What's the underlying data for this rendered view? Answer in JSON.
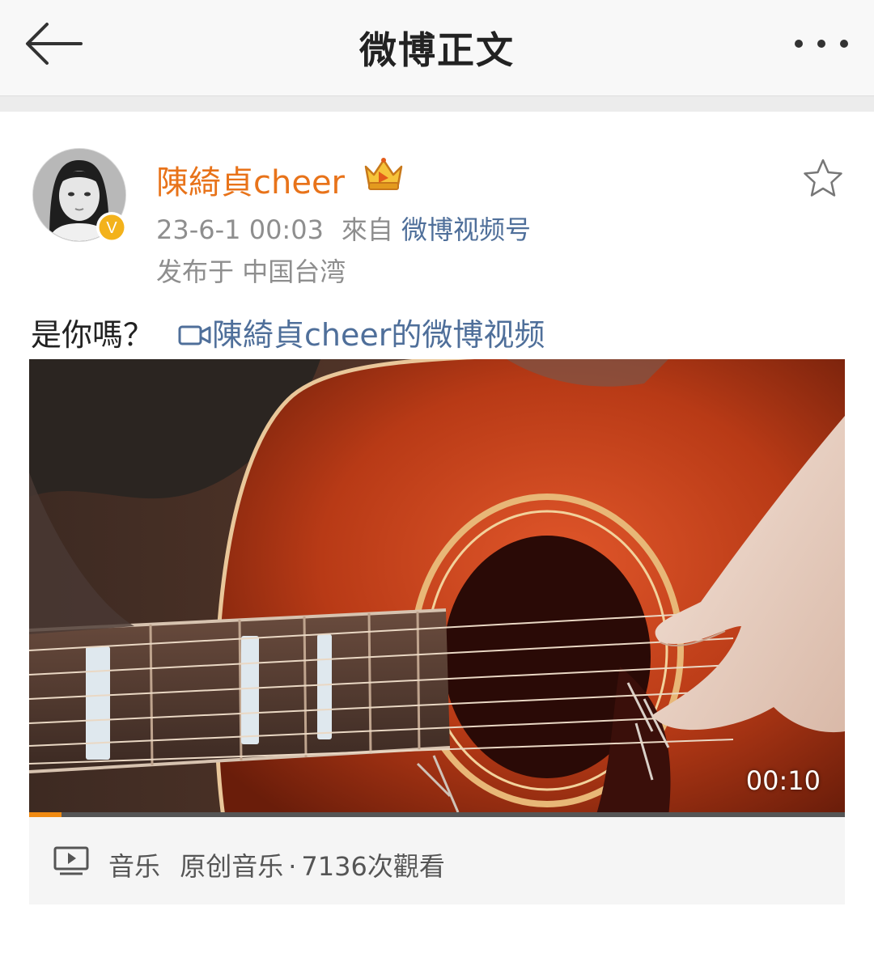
{
  "header": {
    "title": "微博正文",
    "back_icon": "arrow-left-icon",
    "more_icon": "more-dots-icon"
  },
  "post": {
    "author": {
      "name": "陳綺貞cheer",
      "verified_badge": "V",
      "crown_icon": "crown-badge-icon"
    },
    "timestamp": "23-6-1 00:03",
    "from_label": "來自",
    "source": "微博视频号",
    "location_prefix": "发布于",
    "location": "中国台湾",
    "text": "是你嗎？",
    "video_link": "陳綺貞cheer的微博视频",
    "star_icon": "favorite-star-icon"
  },
  "video": {
    "duration": "00:10",
    "progress": 0.04
  },
  "video_info": {
    "category": "音乐",
    "subcategory": "原创音乐",
    "separator": "·",
    "views": "7136次觀看"
  },
  "colors": {
    "accent_orange": "#e8731a",
    "link_blue": "#4f6f9a",
    "verified_gold": "#f3b21b",
    "progress_orange": "#f08a12"
  }
}
